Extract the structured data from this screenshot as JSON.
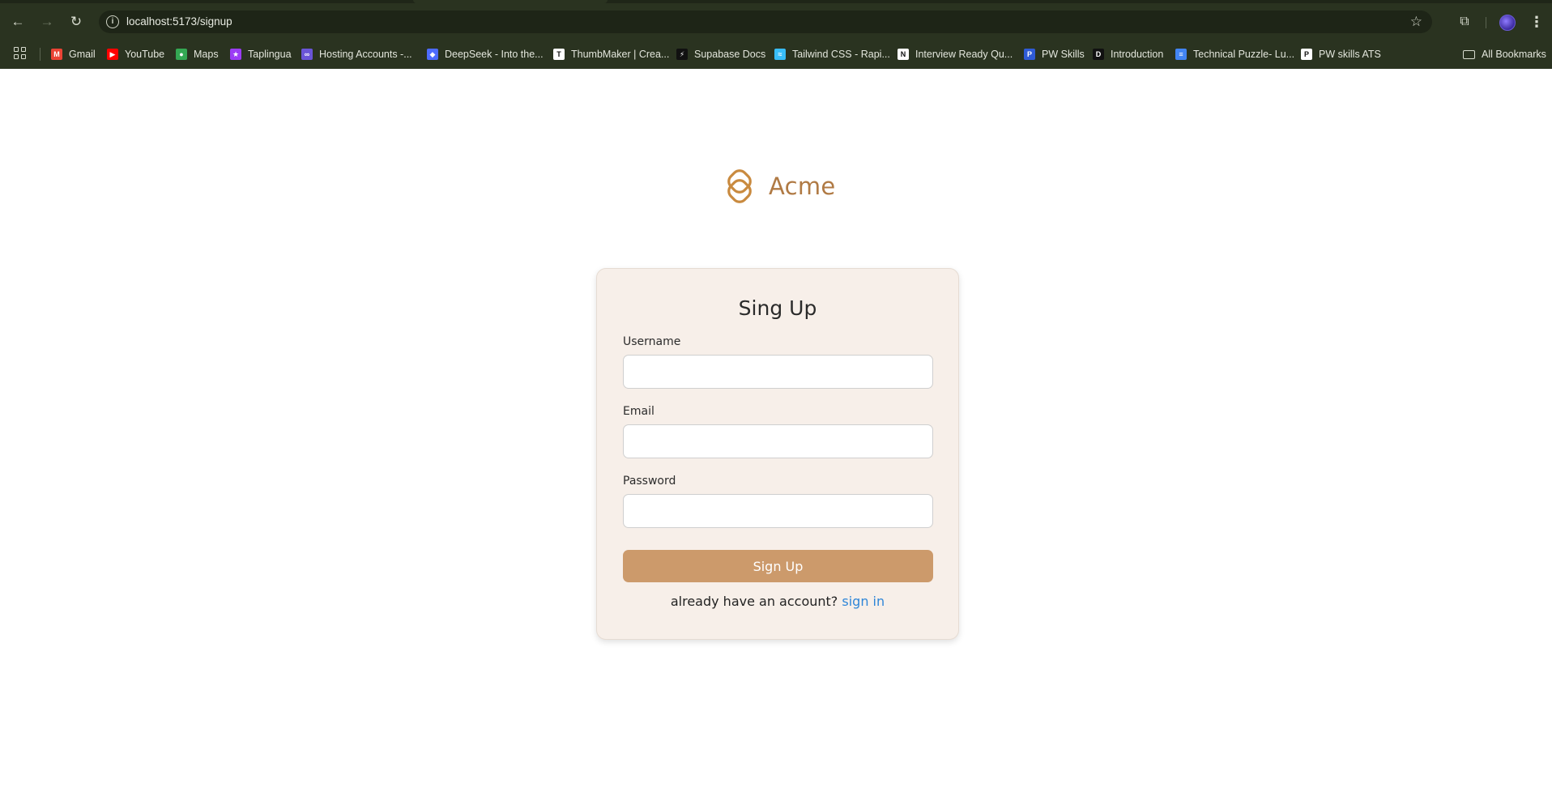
{
  "browser": {
    "url": "localhost:5173/signup",
    "bookmarks": [
      {
        "label": "Gmail",
        "icon": "gmail-icon",
        "color": "#ea4335",
        "glyph": "M"
      },
      {
        "label": "YouTube",
        "icon": "youtube-icon",
        "color": "#ff0000",
        "glyph": "▶"
      },
      {
        "label": "Maps",
        "icon": "maps-icon",
        "color": "#34a853",
        "glyph": "●"
      },
      {
        "label": "Taplingua",
        "icon": "taplingua-icon",
        "color": "#9b3cf5",
        "glyph": "★"
      },
      {
        "label": "Hosting Accounts -...",
        "icon": "infinity-icon",
        "color": "#6a55d8",
        "glyph": "∞"
      },
      {
        "label": "DeepSeek - Into the...",
        "icon": "deepseek-icon",
        "color": "#4d6bfe",
        "glyph": "◆"
      },
      {
        "label": "ThumbMaker | Crea...",
        "icon": "thumbmaker-icon",
        "color": "#ffffff",
        "glyph": "T"
      },
      {
        "label": "Supabase Docs",
        "icon": "supabase-icon",
        "color": "#111111",
        "glyph": "⚡"
      },
      {
        "label": "Tailwind CSS - Rapi...",
        "icon": "tailwind-icon",
        "color": "#38bdf8",
        "glyph": "≈"
      },
      {
        "label": "Interview Ready Qu...",
        "icon": "notion-icon",
        "color": "#ffffff",
        "glyph": "N"
      },
      {
        "label": "PW Skills",
        "icon": "pwskills-icon",
        "color": "#2f5bd6",
        "glyph": "P"
      },
      {
        "label": "Introduction",
        "icon": "docusaurus-icon",
        "color": "#111111",
        "glyph": "D"
      },
      {
        "label": "Technical Puzzle- Lu...",
        "icon": "docs-icon",
        "color": "#4285f4",
        "glyph": "≡"
      },
      {
        "label": "PW skills ATS",
        "icon": "pwats-icon",
        "color": "#ffffff",
        "glyph": "P"
      }
    ],
    "all_bookmarks_label": "All Bookmarks"
  },
  "brand": {
    "name": "Acme",
    "color": "#b07a44"
  },
  "form": {
    "title": "Sing Up",
    "username_label": "Username",
    "username_value": "",
    "email_label": "Email",
    "email_value": "",
    "password_label": "Password",
    "password_value": "",
    "submit_label": "Sign Up",
    "footer_prompt": "already have an account?",
    "footer_link": "sign in",
    "accent_color": "#cc9a6b",
    "card_color": "#f7efe9",
    "link_color": "#2f86d8"
  }
}
